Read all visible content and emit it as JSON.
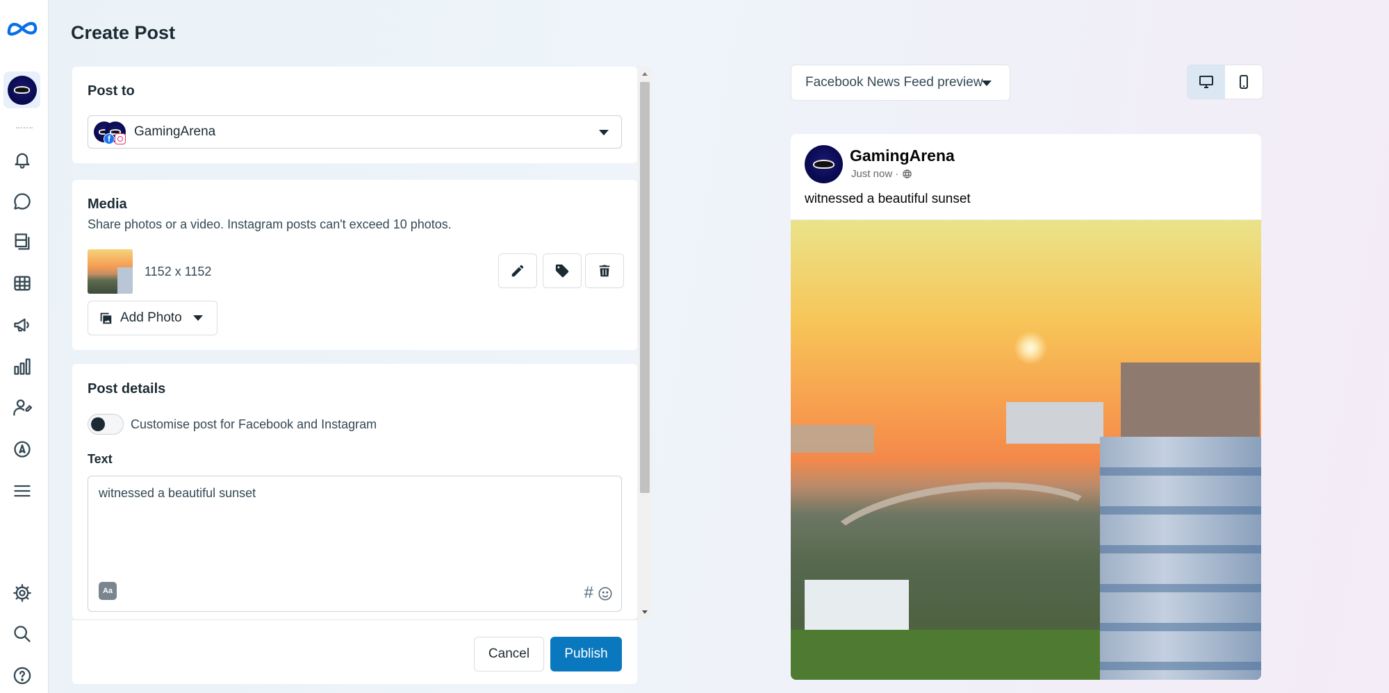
{
  "page": {
    "title": "Create Post"
  },
  "rail": {
    "icons": [
      "meta-logo-icon",
      "account-avatar",
      "bell-icon",
      "chat-icon",
      "pages-icon",
      "table-icon",
      "megaphone-icon",
      "bar-chart-icon",
      "user-edit-icon",
      "compass-icon",
      "menu-icon",
      "gear-icon",
      "search-icon",
      "help-icon"
    ]
  },
  "post_to": {
    "heading": "Post to",
    "account_name": "GamingArena",
    "fb_badge": "f"
  },
  "media": {
    "heading": "Media",
    "description": "Share photos or a video. Instagram posts can't exceed 10 photos.",
    "item_dimensions": "1152 x 1152",
    "add_photo_label": "Add Photo"
  },
  "post_details": {
    "heading": "Post details",
    "customise_label": "Customise post for Facebook and Instagram",
    "customise_enabled": false,
    "text_label": "Text",
    "text_value": "witnessed a beautiful sunset",
    "aa_label": "Aa",
    "hashtag_symbol": "#"
  },
  "footer": {
    "cancel_label": "Cancel",
    "publish_label": "Publish"
  },
  "preview": {
    "select_label": "Facebook News Feed preview",
    "device_selected": "desktop",
    "author": "GamingArena",
    "time": "Just now ·",
    "text": "witnessed a beautiful sunset"
  },
  "colors": {
    "primary": "#0a78be",
    "text": "#1c2b33",
    "facebook_blue": "#1877f2"
  }
}
